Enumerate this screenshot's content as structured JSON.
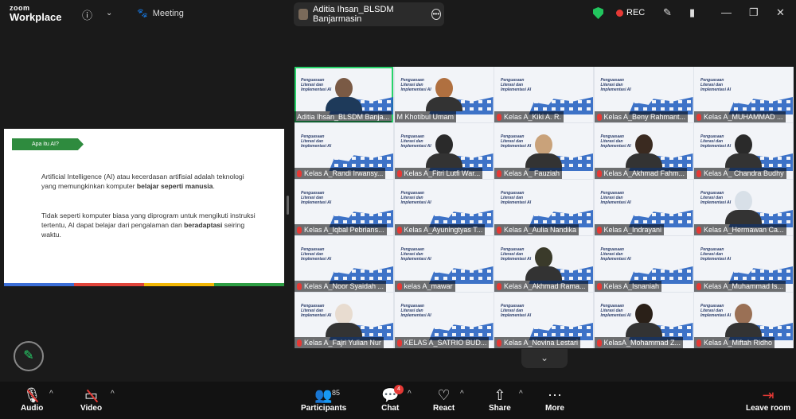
{
  "app": {
    "logo_line1": "zoom",
    "logo_line2": "Workplace"
  },
  "header": {
    "meeting_label": "Meeting",
    "speaker_name": "Aditia Ihsan_BLSDM Banjarmasin",
    "rec_label": "REC"
  },
  "slide": {
    "tag": "Apa itu AI?",
    "p1a": "Artificial Intelligence (AI) atau kecerdasan artifisial adalah teknologi yang memungkinkan komputer ",
    "p1b": "belajar seperti manusia",
    "p1c": ".",
    "p2a": "Tidak seperti komputer biasa yang diprogram untuk mengikuti instruksi tertentu, AI dapat belajar dari pengalaman dan ",
    "p2b": "beradaptasi",
    "p2c": " seiring waktu.",
    "bar_colors": [
      "#3c6fd8",
      "#e0443a",
      "#f2b705",
      "#2e9e44"
    ]
  },
  "tile_slide_title": "Penguasaan Literasi dan Implementasi AI",
  "participants": [
    "Aditia Ihsan_BLSDM Banja...",
    "M Khotibul Umam",
    "Kelas A_Kiki A. R.",
    "Kelas A_Beny Rahmant...",
    "Kelas A_MUHAMMAD ...",
    "Kelas A_Randi Irwansy...",
    "Kelas A_Fitri Lutfi War...",
    "Kelas A_ Fauziah",
    "Kelas A_Akhmad Fahm...",
    "Kelas A_ Chandra Budhy",
    "Kelas A_Iqbal Pebrians...",
    "Kelas A_Ayuningtyas T...",
    "Kelas A_Aulia Nandika",
    "Kelas A_Indrayani",
    "Kelas A_Hermawan Ca...",
    "Kelas A_Noor Syaidah ...",
    "kelas A_mawar",
    "Kelas A_Akhmad Rama...",
    "Kelas A_Isnaniah",
    "Kelas A_Muhammad Is...",
    "Kelas A_Fajri Yulian Nur",
    "KELAS A_SATRIO BUD...",
    "Kelas A_Novina Lestari",
    "KelasA_Mohammad Z...",
    "Kelas A_Miftah Ridho"
  ],
  "toolbar": {
    "audio": "Audio",
    "video": "Video",
    "participants": "Participants",
    "participants_count": "85",
    "chat": "Chat",
    "chat_badge": "4",
    "react": "React",
    "share": "Share",
    "more": "More",
    "leave": "Leave room"
  }
}
